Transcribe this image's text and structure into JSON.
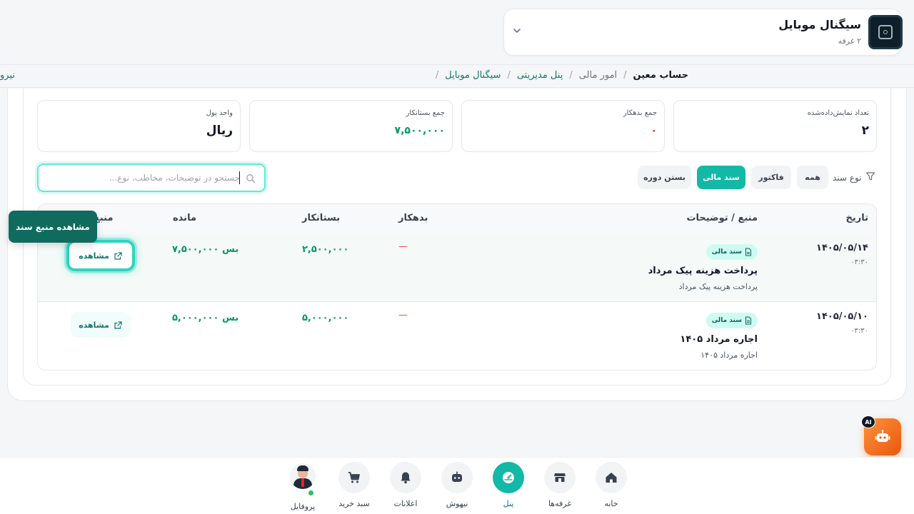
{
  "shop": {
    "name": "سیگنال موبایل",
    "rooms": "۲ غرفه"
  },
  "breadcrumb": {
    "cut_item": "نیرو",
    "items": [
      "سیگنال موبایل",
      "پنل مدیریتی",
      "امور مالی",
      "حساب معین"
    ]
  },
  "stats": [
    {
      "label": "تعداد نمایش‌داده‌شده",
      "value": "۲"
    },
    {
      "label": "جمع بدهکار",
      "value": "۰"
    },
    {
      "label": "جمع بستانکار",
      "value": "۷,۵۰۰,۰۰۰"
    },
    {
      "label": "واحد پول",
      "value": "ریال"
    }
  ],
  "filters": {
    "label": "نوع سند",
    "chips": [
      "همه",
      "فاکتور",
      "سند مالی",
      "بستن دوره"
    ],
    "active": "سند مالی"
  },
  "search": {
    "placeholder": "جستجو در توضیحات، مخاطب، نوع...",
    "value": ""
  },
  "table": {
    "headers": {
      "date": "تاریخ",
      "source": "منبع / توضیحات",
      "debit": "بدهکار",
      "credit": "بستانکار",
      "balance": "مانده",
      "action": "منبع"
    },
    "rows": [
      {
        "date": "۱۴۰۵/۰۵/۱۴",
        "time": "۰۳:۳۰",
        "badge": "سند مالی",
        "title": "پرداخت هزینه پیک مرداد",
        "subtitle": "پرداخت هزینه پیک مرداد",
        "debit": "—",
        "credit": "۲,۵۰۰,۰۰۰",
        "balance": "بس ۷,۵۰۰,۰۰۰",
        "action": "مشاهده"
      },
      {
        "date": "۱۴۰۵/۰۵/۱۰",
        "time": "۰۳:۳۰",
        "badge": "سند مالی",
        "title": "اجاره مرداد ۱۴۰۵",
        "subtitle": "اجاره مرداد ۱۴۰۵",
        "debit": "—",
        "credit": "۵,۰۰۰,۰۰۰",
        "balance": "بس ۵,۰۰۰,۰۰۰",
        "action": "مشاهده"
      }
    ]
  },
  "tooltip": "مشاهده منبع سند",
  "ai_button": {
    "badge": "AI"
  },
  "bottom_nav": {
    "items": [
      "خانه",
      "غرفه‌ها",
      "پنل",
      "نیهوش",
      "اعلانات",
      "سبد خرید",
      "پروفایل"
    ],
    "active": "پنل"
  },
  "colors": {
    "accent": "#14b8a6",
    "positive": "#059669",
    "negative": "#dc2626",
    "ai": "#f97316"
  }
}
